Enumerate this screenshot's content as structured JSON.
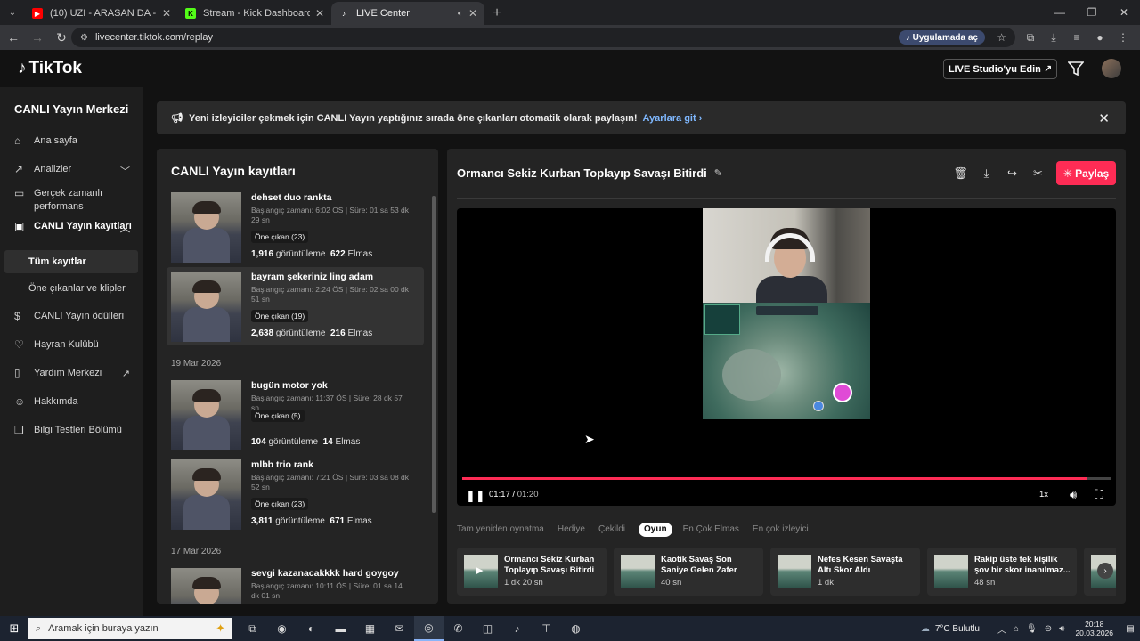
{
  "browser": {
    "tabs": [
      {
        "title": "(10) UZI - ARASAN DA - YouTube",
        "favicon": "youtube-icon",
        "color": "#ff0000"
      },
      {
        "title": "Stream - Kick Dashboard",
        "favicon": "kick-icon",
        "color": "#53fc18"
      },
      {
        "title": "LIVE Center",
        "favicon": "tiktok-icon",
        "color": "#ffffff"
      }
    ],
    "url": "livecenter.tiktok.com/replay",
    "open_in_app": "Uygulamada aç"
  },
  "header": {
    "logo": "TikTok",
    "studio_button": "LIVE Studio'yu Edin"
  },
  "sidebar": {
    "title": "CANLI Yayın Merkezi",
    "items": [
      {
        "label": "Ana sayfa",
        "icon": "home-icon"
      },
      {
        "label": "Analizler",
        "icon": "chart-icon"
      },
      {
        "label": "Gerçek zamanlı performans",
        "icon": "monitor-icon"
      },
      {
        "label": "CANLI Yayın kayıtları",
        "icon": "video-icon"
      },
      {
        "label": "CANLI Yayın ödülleri",
        "icon": "coin-icon"
      },
      {
        "label": "Hayran Kulübü",
        "icon": "heart-icon"
      },
      {
        "label": "Yardım Merkezi",
        "icon": "book-icon"
      },
      {
        "label": "Hakkımda",
        "icon": "user-icon"
      },
      {
        "label": "Bilgi Testleri Bölümü",
        "icon": "quiz-icon"
      }
    ],
    "sub_items": [
      {
        "label": "Tüm kayıtlar"
      },
      {
        "label": "Öne çıkanlar ve klipler"
      }
    ]
  },
  "banner": {
    "text": "Yeni izleyiciler çekmek için CANLI Yayın yaptığınız sırada öne çıkanları otomatik olarak paylaşın!",
    "link": "Ayarlara git"
  },
  "recordings": {
    "title": "CANLI Yayın kayıtları",
    "dates": [
      "19 Mar 2026",
      "17 Mar 2026"
    ],
    "items": [
      {
        "name": "dehset duo rankta",
        "meta": "Başlangıç zamanı: 6:02 ÖS | Süre: 01 sa 53 dk 29 sn",
        "badge": "Öne çıkan (23)",
        "views": "1,916",
        "views_label": "görüntüleme",
        "diamonds": "622",
        "diamonds_label": "Elmas"
      },
      {
        "name": "bayram şekeriniz ling adam",
        "meta": "Başlangıç zamanı: 2:24 ÖS | Süre: 02 sa 00 dk 51 sn",
        "badge": "Öne çıkan (19)",
        "views": "2,638",
        "views_label": "görüntüleme",
        "diamonds": "216",
        "diamonds_label": "Elmas"
      },
      {
        "name": "bugün motor yok",
        "meta": "Başlangıç zamanı: 11:37 ÖS | Süre: 28 dk 57 sn",
        "badge": "Öne çıkan (5)",
        "views": "104",
        "views_label": "görüntüleme",
        "diamonds": "14",
        "diamonds_label": "Elmas"
      },
      {
        "name": "mlbb trio rank",
        "meta": "Başlangıç zamanı: 7:21 ÖS | Süre: 03 sa 08 dk 52 sn",
        "badge": "Öne çıkan (23)",
        "views": "3,811",
        "views_label": "görüntüleme",
        "diamonds": "671",
        "diamonds_label": "Elmas"
      },
      {
        "name": "sevgi kazanacakkkk hard goygoy",
        "meta": "Başlangıç zamanı: 10:11 ÖS | Süre: 01 sa 14 dk 01 sn",
        "badge": "",
        "views": "",
        "views_label": "",
        "diamonds": "",
        "diamonds_label": ""
      }
    ]
  },
  "player": {
    "title": "Ormancı Sekiz Kurban Toplayıp Savaşı Bitirdi",
    "share_label": "Paylaş",
    "current_time": "01:17",
    "duration": "01:20",
    "progress": 0.9625,
    "speed": "1x"
  },
  "chapters": {
    "tabs": [
      "Tam yeniden oynatma",
      "Hediye",
      "Çekildi",
      "Oyun",
      "En Çok Elmas",
      "En çok izleyici"
    ],
    "active": "Oyun"
  },
  "clips": [
    {
      "title": "Ormancı Sekiz Kurban Toplayıp Savaşı Bitirdi",
      "duration": "1 dk 20 sn"
    },
    {
      "title": "Kaotik Savaş Son Saniye Gelen Zafer",
      "duration": "40 sn"
    },
    {
      "title": "Nefes Kesen Savaşta Altı Skor Aldı",
      "duration": "1 dk"
    },
    {
      "title": "Rakip üste tek kişilik şov bir skor inanılmaz...",
      "duration": "48 sn"
    }
  ],
  "taskbar": {
    "search_placeholder": "Aramak için buraya yazın",
    "weather": "7°C  Bulutlu",
    "time": "20:18",
    "date": "20.03.2026"
  },
  "colors": {
    "accent": "#fe2c55",
    "link": "#7fb8ff"
  }
}
